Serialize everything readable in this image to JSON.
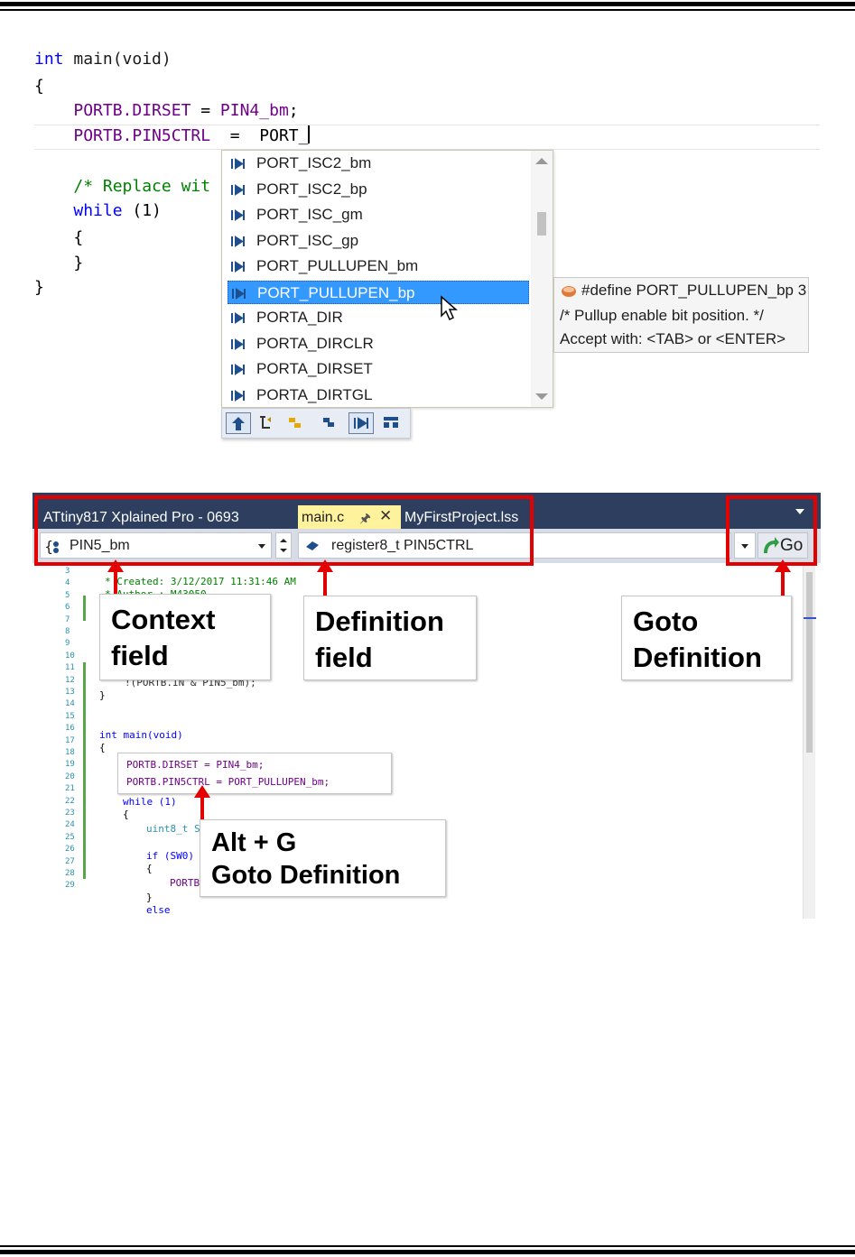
{
  "code_top": {
    "lines": [
      [
        "int",
        " main(void)"
      ],
      "{",
      [
        "    ",
        "PORTB.DIRSET",
        " = ",
        "PIN4_bm",
        ";"
      ],
      [
        "    ",
        "PORTB.PIN5CTRL",
        "  =  ",
        "PORT_"
      ],
      "",
      [
        "    ",
        "/* Replace wit"
      ],
      [
        "    ",
        "while",
        " (1)"
      ],
      "    {",
      "    }",
      "}"
    ]
  },
  "autocomplete": {
    "items": [
      "PORT_ISC2_bm",
      "PORT_ISC2_bp",
      "PORT_ISC_gm",
      "PORT_ISC_gp",
      "PORT_PULLUPEN_bm",
      "PORT_PULLUPEN_bp",
      "PORTA_DIR",
      "PORTA_DIRCLR",
      "PORTA_DIRSET",
      "PORTA_DIRTGL"
    ],
    "selected_index": 5,
    "filters": [
      "up-arrow-icon",
      "namespace-icon",
      "class-icon",
      "struct-icon",
      "macro-icon",
      "member-icon"
    ]
  },
  "tooltip": {
    "line1": "#define PORT_PULLUPEN_bp 3",
    "line2": "/* Pullup enable bit position. */",
    "line3": "Accept with: <TAB> or <ENTER>"
  },
  "ide": {
    "title": "ATtiny817 Xplained Pro - 0693",
    "tabs": [
      {
        "label": "main.c",
        "active": true
      },
      {
        "label": "MyFirstProject.lss",
        "active": false
      }
    ],
    "context_value": "PIN5_bm",
    "definition_value": "register8_t PIN5CTRL",
    "go_label": "Go",
    "line_numbers": [
      "3",
      "4",
      "5",
      "6",
      "7",
      "8",
      "9",
      "10",
      "11",
      "12",
      "13",
      "14",
      "15",
      "16",
      "17",
      "18",
      "19",
      "20",
      "21",
      "22",
      "23",
      "24",
      "25",
      "26",
      "27",
      "28",
      "29"
    ],
    "code": {
      "created": "* Created: 3/12/2017 11:31:46 AM",
      "author": "* Author : M43050",
      "ret": "!(PORTB.IN & PIN5_bm);",
      "close1": "}",
      "main": "int main(void)",
      "open": "{",
      "dirset": "PORTB.DIRSET = PIN4_bm;",
      "pinctrl": "PORTB.PIN5CTRL = PORT_PULLUPEN_bm;",
      "while": "while (1)",
      "wopen": "{",
      "uint": "uint8_t S",
      "if": "if (SW0)",
      "iopen": "{",
      "port": "PORTB",
      "iclose": "}",
      "else": "else"
    }
  },
  "callouts": {
    "context": [
      "Context",
      "field"
    ],
    "definition": [
      "Definition",
      "field"
    ],
    "goto": [
      "Goto",
      "Definition"
    ],
    "altg": [
      "Alt + G",
      "Goto Definition"
    ]
  },
  "colors": {
    "highlight_red": "#e30000",
    "selection_blue": "#3399ff",
    "tab_yellow": "#fff29d"
  }
}
